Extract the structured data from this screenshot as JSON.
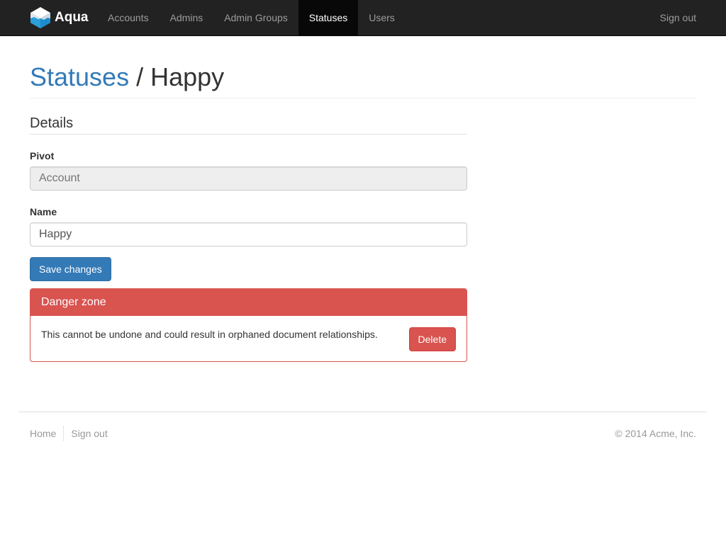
{
  "navbar": {
    "brand": "Aqua",
    "items": [
      {
        "label": "Accounts",
        "active": false
      },
      {
        "label": "Admins",
        "active": false
      },
      {
        "label": "Admin Groups",
        "active": false
      },
      {
        "label": "Statuses",
        "active": true
      },
      {
        "label": "Users",
        "active": false
      }
    ],
    "sign_out": "Sign out"
  },
  "header": {
    "crumb": "Statuses",
    "separator": " / ",
    "current": "Happy"
  },
  "details": {
    "title": "Details",
    "pivot_label": "Pivot",
    "pivot_placeholder": "Account",
    "name_label": "Name",
    "name_value": "Happy",
    "save_label": "Save changes"
  },
  "danger": {
    "title": "Danger zone",
    "message": "This cannot be undone and could result in orphaned document relationships.",
    "delete_label": "Delete"
  },
  "footer": {
    "home": "Home",
    "sign_out": "Sign out",
    "copyright": "© 2014 Acme, Inc."
  },
  "colors": {
    "navbar_bg": "#222222",
    "primary": "#337ab7",
    "danger": "#d9534f"
  }
}
